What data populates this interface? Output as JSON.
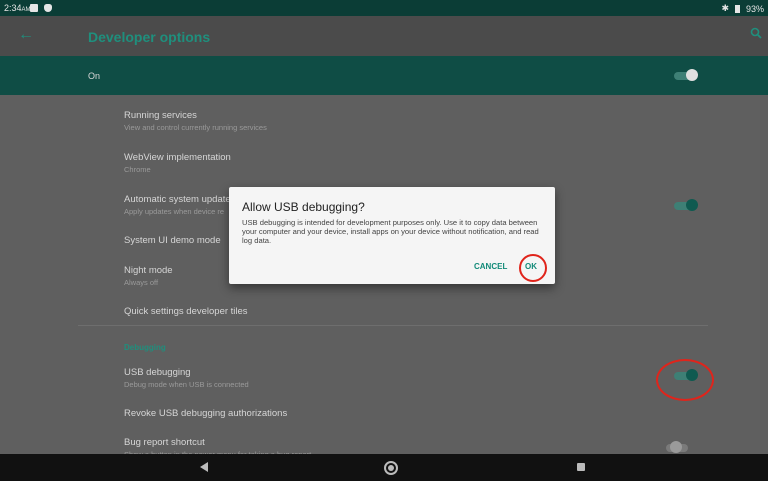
{
  "status_bar": {
    "time": "2:34",
    "ampm": "AM",
    "battery": "93%",
    "icons": [
      "image-icon",
      "shield-icon",
      "bluetooth-icon",
      "battery-icon"
    ]
  },
  "toolbar": {
    "title": "Developer options",
    "back_icon": "arrow-left-icon",
    "search_icon": "search-icon"
  },
  "master_switch": {
    "label": "On",
    "state": "on"
  },
  "settings": [
    {
      "title": "Running services",
      "summary": "View and control currently running services"
    },
    {
      "title": "WebView implementation",
      "summary": "Chrome"
    },
    {
      "title": "Automatic system updates",
      "summary": "Apply updates when device re",
      "toggle": "on"
    },
    {
      "title": "System UI demo mode"
    },
    {
      "title": "Night mode",
      "summary": "Always off"
    },
    {
      "title": "Quick settings developer tiles"
    }
  ],
  "category": "Debugging",
  "debug_settings": [
    {
      "title": "USB debugging",
      "summary": "Debug mode when USB is connected",
      "toggle": "on"
    },
    {
      "title": "Revoke USB debugging authorizations"
    },
    {
      "title": "Bug report shortcut",
      "summary": "Show a button in the power menu for taking a bug report",
      "toggle": "off"
    }
  ],
  "dialog": {
    "title": "Allow USB debugging?",
    "message": "USB debugging is intended for development purposes only. Use it to copy data between your computer and your device, install apps on your device without notification, and read log data.",
    "cancel": "CANCEL",
    "ok": "OK"
  },
  "colors": {
    "accent": "#1f8f7d",
    "highlight": "#e0241b"
  }
}
